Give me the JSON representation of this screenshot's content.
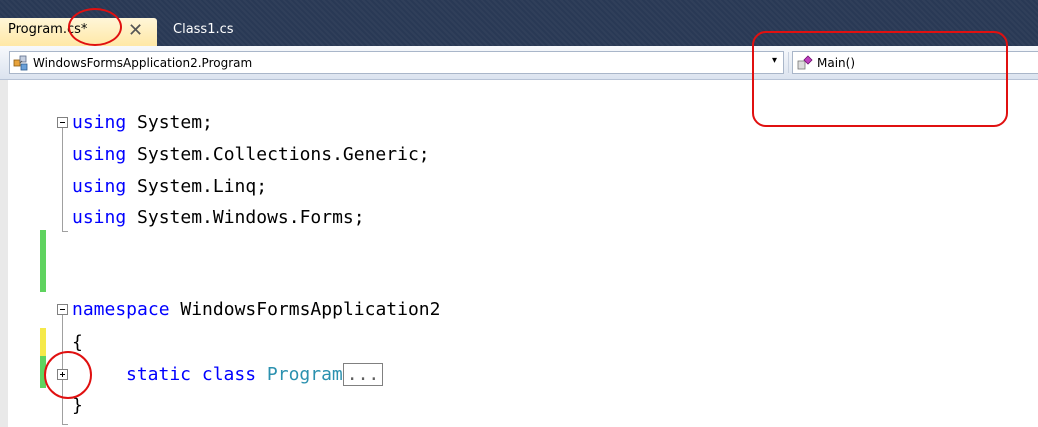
{
  "tabs": [
    {
      "label": "Program.cs*",
      "active": true
    },
    {
      "label": "Class1.cs",
      "active": false
    }
  ],
  "navbar": {
    "type_combo": "WindowsFormsApplication2.Program",
    "member_combo": "Main()",
    "dropdown_arrow": "▾"
  },
  "code": {
    "lines": [
      {
        "kw": "using",
        "rest": " System;"
      },
      {
        "kw": "using",
        "rest": " System.Collections.Generic;"
      },
      {
        "kw": "using",
        "rest": " System.Linq;"
      },
      {
        "kw": "using",
        "rest": " System.Windows.Forms;"
      },
      {
        "kw": "namespace",
        "rest": " WindowsFormsApplication2"
      },
      {
        "text": "{"
      },
      {
        "kw": "static class",
        "type": "Program",
        "collapsed": "..."
      },
      {
        "text": "}"
      }
    ]
  },
  "colors": {
    "tabstrip": "#293955",
    "keyword": "#0000ff",
    "type": "#2b91af",
    "annotation": "#e01010",
    "change_saved": "#5fd35f",
    "change_unsaved": "#f5e94a"
  },
  "icons": {
    "close": "close-icon",
    "type": "class-icon",
    "member": "method-icon",
    "expand": "expand-plus-icon",
    "collapse": "collapse-minus-icon"
  }
}
